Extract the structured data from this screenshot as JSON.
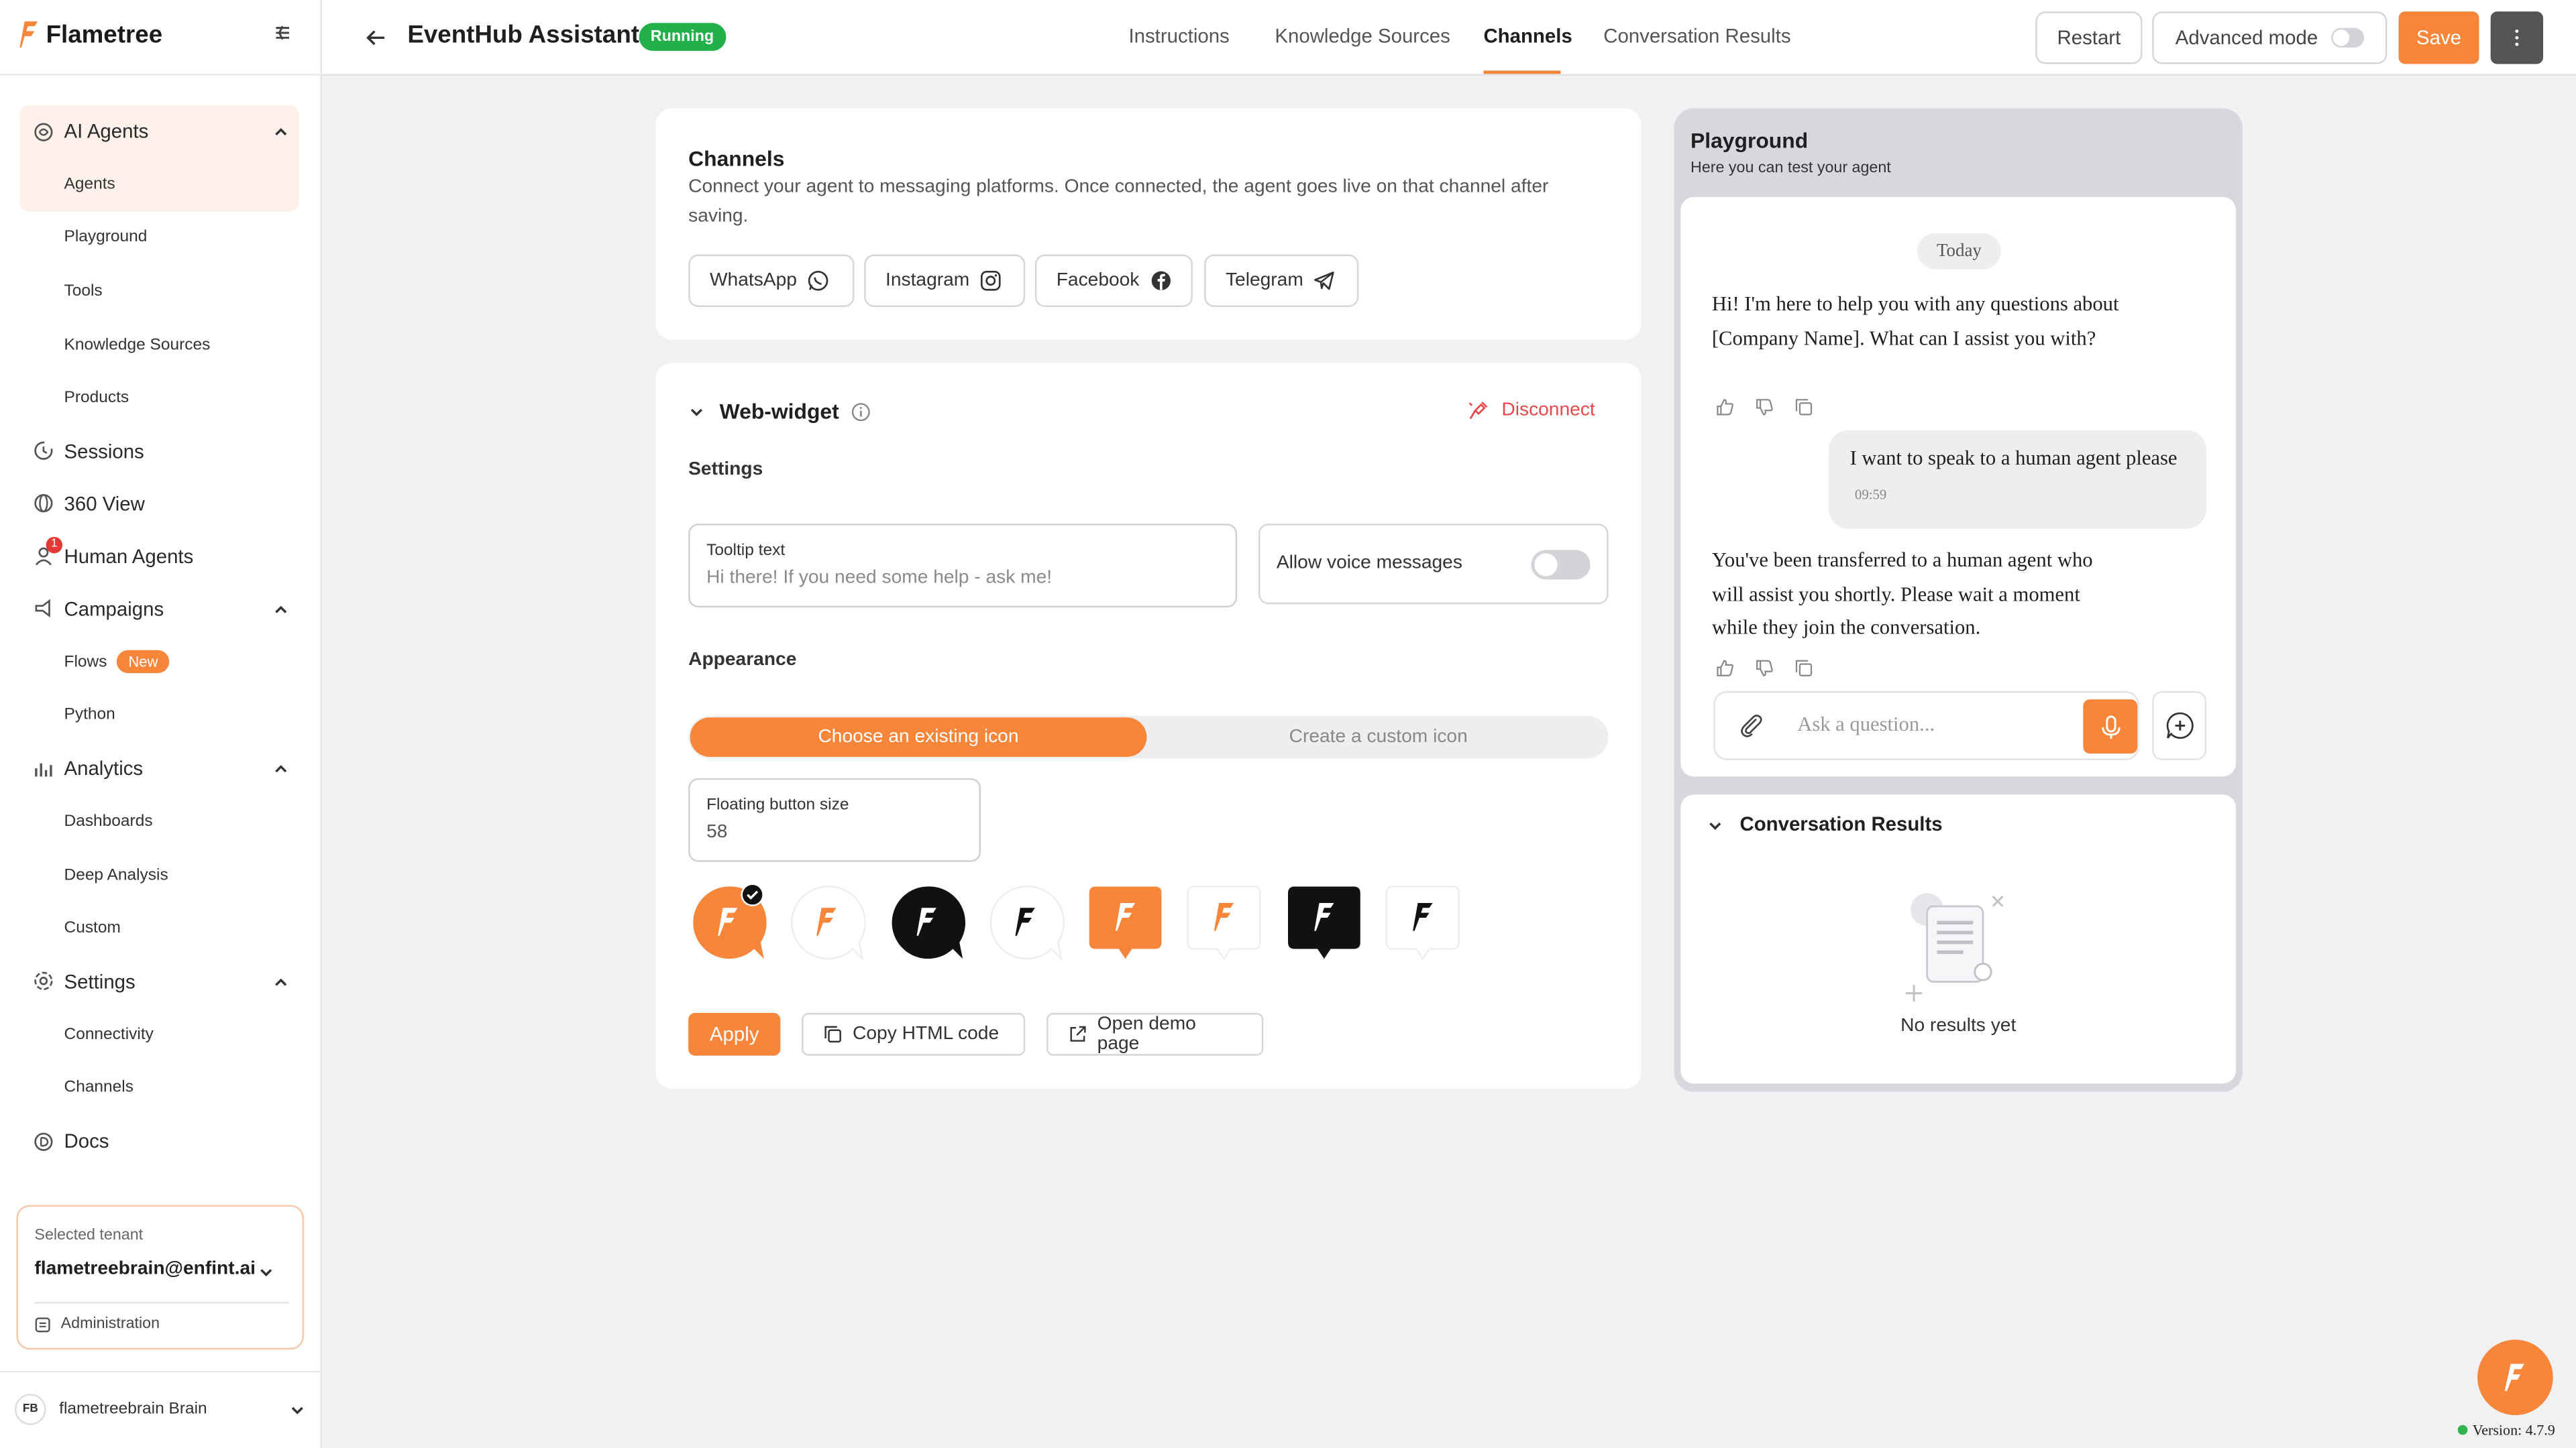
{
  "app": {
    "brand": "Flametree",
    "accent": "#f7863a"
  },
  "sidebar": {
    "groups": [
      {
        "label": "AI Agents",
        "expanded": true,
        "icon": "brain-icon"
      },
      {
        "label": "Sessions",
        "icon": "history-icon"
      },
      {
        "label": "360 View",
        "icon": "globe-icon"
      },
      {
        "label": "Human Agents",
        "icon": "user-icon",
        "badge": "1"
      },
      {
        "label": "Campaigns",
        "expanded": true,
        "icon": "megaphone-icon"
      },
      {
        "label": "Analytics",
        "expanded": true,
        "icon": "bar-chart-icon"
      },
      {
        "label": "Settings",
        "expanded": true,
        "icon": "gear-icon"
      },
      {
        "label": "Docs",
        "icon": "docs-icon"
      }
    ],
    "agents_items": [
      "Agents",
      "Playground",
      "Tools",
      "Knowledge Sources",
      "Products"
    ],
    "campaigns_items": [
      "Flows",
      "Python"
    ],
    "flows_badge": "New",
    "analytics_items": [
      "Dashboards",
      "Deep Analysis",
      "Custom"
    ],
    "settings_items": [
      "Connectivity",
      "Channels"
    ],
    "tenant": {
      "label": "Selected tenant",
      "value": "flametreebrain@enfint.ai",
      "admin": "Administration"
    },
    "brain": {
      "initials": "FB",
      "name": "flametreebrain Brain"
    }
  },
  "header": {
    "title": "EventHub Assistant",
    "status": "Running",
    "tabs": [
      "Instructions",
      "Knowledge Sources",
      "Channels",
      "Conversation Results"
    ],
    "active_tab": "Channels",
    "restart": "Restart",
    "advanced_mode": "Advanced mode",
    "save": "Save"
  },
  "channels": {
    "title": "Channels",
    "description": "Connect your agent to messaging platforms. Once connected, the agent goes live on that channel after saving.",
    "buttons": [
      "WhatsApp",
      "Instagram",
      "Facebook",
      "Telegram"
    ]
  },
  "widget": {
    "title": "Web-widget",
    "disconnect": "Disconnect",
    "settings_heading": "Settings",
    "tooltip_label": "Tooltip text",
    "tooltip_placeholder": "Hi there! If you need some help - ask me!",
    "voice_label": "Allow voice messages",
    "voice_enabled": false,
    "appearance_heading": "Appearance",
    "seg_existing": "Choose an existing icon",
    "seg_custom": "Create a custom icon",
    "size_label": "Floating button size",
    "size_value": "58",
    "selected_icon_index": 0,
    "apply": "Apply",
    "copy_html": "Copy HTML code",
    "open_demo": "Open demo page"
  },
  "playground": {
    "title": "Playground",
    "subtitle": "Here you can test your agent",
    "day_label": "Today",
    "messages": [
      {
        "role": "bot",
        "text": "Hi! I'm here to help you with any questions about [Company Name]. What can I assist you with?"
      },
      {
        "role": "user",
        "text": "I want to speak to a human agent please",
        "time": "09:59"
      },
      {
        "role": "bot",
        "text": "You've been transferred to a human agent who will assist you shortly. Please wait a moment while they join the conversation."
      }
    ],
    "input_placeholder": "Ask a question...",
    "results_title": "Conversation Results",
    "no_results": "No results yet"
  },
  "version": "Version: 4.7.9"
}
